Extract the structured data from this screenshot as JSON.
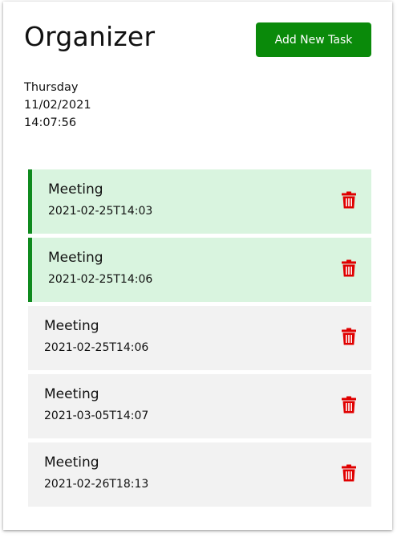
{
  "header": {
    "title": "Organizer",
    "add_button_label": "Add New Task"
  },
  "clock": {
    "day": "Thursday",
    "date": "11/02/2021",
    "time": "14:07:56"
  },
  "tasks": [
    {
      "name": "Meeting",
      "datetime": "2021-02-25T14:03",
      "highlighted": true,
      "icon": "trash-icon"
    },
    {
      "name": "Meeting",
      "datetime": "2021-02-25T14:06",
      "highlighted": true,
      "icon": "trash-icon"
    },
    {
      "name": "Meeting",
      "datetime": "2021-02-25T14:06",
      "highlighted": false,
      "icon": "trash-icon"
    },
    {
      "name": "Meeting",
      "datetime": "2021-03-05T14:07",
      "highlighted": false,
      "icon": "trash-icon"
    },
    {
      "name": "Meeting",
      "datetime": "2021-02-26T18:13",
      "highlighted": false,
      "icon": "trash-icon"
    }
  ],
  "colors": {
    "accent_green": "#0a8a0a",
    "highlight_bg": "#d9f4df",
    "highlight_border": "#0f8a1e",
    "item_bg": "#f2f2f2",
    "delete_red": "#e00000"
  }
}
